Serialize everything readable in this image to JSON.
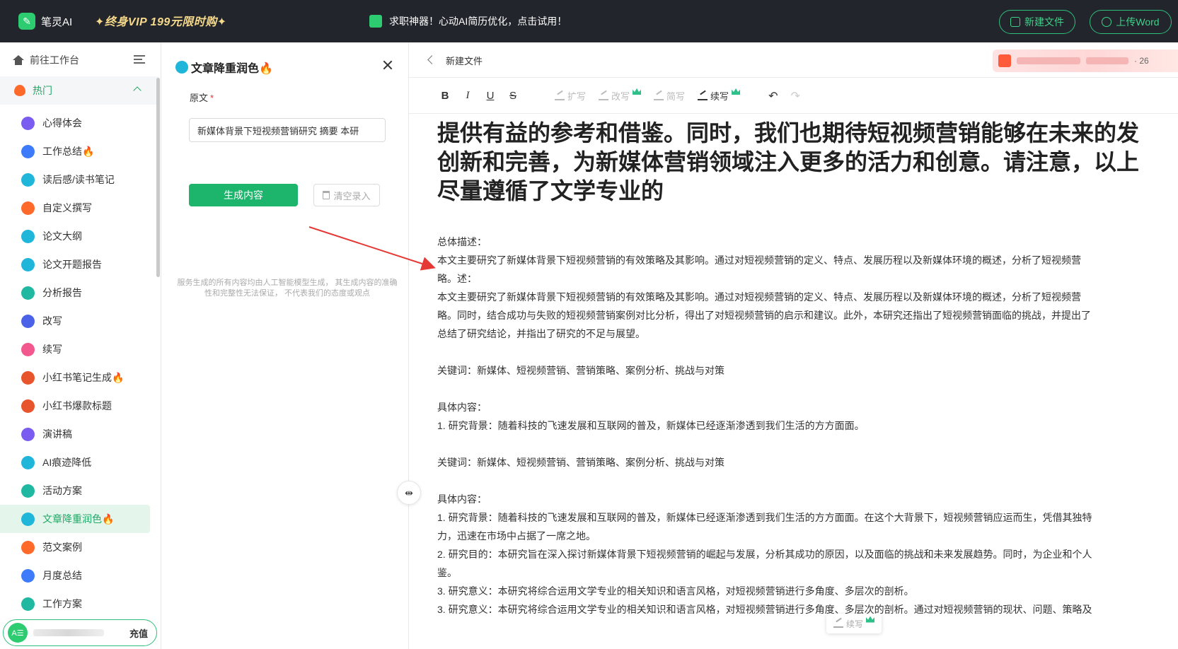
{
  "topbar": {
    "app_name": "笔灵AI",
    "vip_promo": "✦终身VIP 199元限时购✦",
    "announcement": "求职神器！心动AI简历优化，点击试用！",
    "new_file_label": "新建文件",
    "upload_word_label": "上传Word"
  },
  "sidebar": {
    "workspace_label": "前往工作台",
    "hot_label": "热门",
    "items": [
      {
        "label": "心得体会",
        "icon": "document-icon",
        "color": "#7a5cf0"
      },
      {
        "label": "工作总结🔥",
        "icon": "briefcase-icon",
        "color": "#3e7bfa"
      },
      {
        "label": "读后感/读书笔记",
        "icon": "book-icon",
        "color": "#1fb6d9"
      },
      {
        "label": "自定义撰写",
        "icon": "fire-icon",
        "color": "#ff6a2b"
      },
      {
        "label": "论文大纲",
        "icon": "outline-icon",
        "color": "#1fb6d9"
      },
      {
        "label": "论文开题报告",
        "icon": "report-icon",
        "color": "#1fb6d9"
      },
      {
        "label": "分析报告",
        "icon": "chart-icon",
        "color": "#20b8a0"
      },
      {
        "label": "改写",
        "icon": "pen-icon",
        "color": "#4b62e8"
      },
      {
        "label": "续写",
        "icon": "continue-icon",
        "color": "#f2578d"
      },
      {
        "label": "小红书笔记生成🔥",
        "icon": "xiaohongshu-icon",
        "color": "#e8542b"
      },
      {
        "label": "小红书爆款标题",
        "icon": "xiaohongshu-icon",
        "color": "#e8542b"
      },
      {
        "label": "演讲稿",
        "icon": "speech-icon",
        "color": "#7a5cf0"
      },
      {
        "label": "AI痕迹降低",
        "icon": "ai-icon",
        "color": "#1fb6d9"
      },
      {
        "label": "活动方案",
        "icon": "plan-icon",
        "color": "#20b8a0"
      },
      {
        "label": "文章降重润色🔥",
        "icon": "polish-icon",
        "color": "#1fb6d9",
        "active": true
      },
      {
        "label": "范文案例",
        "icon": "fire-icon",
        "color": "#ff6a2b"
      },
      {
        "label": "月度总结",
        "icon": "briefcase-icon",
        "color": "#3e7bfa"
      },
      {
        "label": "工作方案",
        "icon": "plan-icon",
        "color": "#20b8a0"
      }
    ],
    "avatar_text": "A☰",
    "recharge_label": "充值"
  },
  "panel": {
    "title": "文章降重润色🔥",
    "source_label": "原文",
    "required_mark": "*",
    "source_value": "新媒体背景下短视频营销研究 摘要 本研",
    "generate_label": "生成内容",
    "clear_label": "清空录入",
    "disclaimer": "服务生成的所有内容均由人工智能模型生成， 其生成内容的准确性和完整性无法保证， 不代表我们的态度或观点"
  },
  "editor": {
    "doc_name": "新建文件",
    "gift_text": "· 26",
    "toolbar": {
      "bold": "B",
      "italic": "I",
      "underline": "U",
      "strike": "S",
      "expand": "扩写",
      "rewrite": "改写",
      "simplify": "简写",
      "continue": "续写",
      "undo": "↶",
      "redo": "↷"
    },
    "heading_lines": [
      "提供有益的参考和借鉴。同时，我们也期待短视频营销能够在未来的发",
      "创新和完善，为新媒体营销领域注入更多的活力和创意。请注意，以上",
      "尽量遵循了文学专业的"
    ],
    "paragraphs": [
      "总体描述：",
      "本文主要研究了新媒体背景下短视频营销的有效策略及其影响。通过对短视频营销的定义、特点、发展历程以及新媒体环境的概述，分析了短视频营",
      "略。述：",
      "本文主要研究了新媒体背景下短视频营销的有效策略及其影响。通过对短视频营销的定义、特点、发展历程以及新媒体环境的概述，分析了短视频营",
      "略。同时，结合成功与失败的短视频营销案例对比分析，得出了对短视频营销的启示和建议。此外，本研究还指出了短视频营销面临的挑战，并提出了",
      "总结了研究结论，并指出了研究的不足与展望。",
      "",
      "关键词：新媒体、短视频营销、营销策略、案例分析、挑战与对策",
      "",
      "具体内容：",
      "1. 研究背景：随着科技的飞速发展和互联网的普及，新媒体已经逐渐渗透到我们生活的方方面面。",
      "",
      "关键词：新媒体、短视频营销、营销策略、案例分析、挑战与对策",
      "",
      "具体内容：",
      "1. 研究背景：随着科技的飞速发展和互联网的普及，新媒体已经逐渐渗透到我们生活的方方面面。在这个大背景下，短视频营销应运而生，凭借其独特",
      "力，迅速在市场中占据了一席之地。",
      "2. 研究目的：本研究旨在深入探讨新媒体背景下短视频营销的崛起与发展，分析其成功的原因，以及面临的挑战和未来发展趋势。同时，为企业和个人",
      "鉴。",
      "3. 研究意义：本研究将综合运用文学专业的相关知识和语言风格，对短视频营销进行多角度、多层次的剖析。",
      "3. 研究意义：本研究将综合运用文学专业的相关知识和语言风格，对短视频营销进行多角度、多层次的剖析。通过对短视频营销的现状、问题、策略及"
    ],
    "float_continue_label": "续写"
  },
  "colors": {
    "accent": "#1db46c",
    "topbar_bg": "#22252b",
    "active_bg": "#e4f5ec",
    "arrow": "#e53935"
  }
}
